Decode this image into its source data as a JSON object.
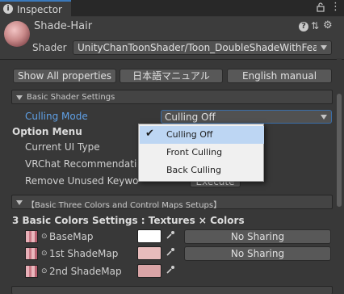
{
  "window": {
    "tab_label": "Inspector",
    "tab_icon": "info-icon",
    "tab_actions": [
      "lock-icon",
      "menu-icon"
    ]
  },
  "header": {
    "material_name": "Shade-Hair",
    "shader_label": "Shader",
    "shader_value": "UnityChanToonShader/Toon_DoubleShadeWithFeath",
    "icons": [
      "help-icon",
      "presets-icon",
      "settings-icon"
    ]
  },
  "buttons": {
    "show_all": "Show All properties",
    "japanese_manual": "日本語マニュアル",
    "english_manual": "English manual"
  },
  "basic_shader_settings": {
    "title": "Basic Shader Settings",
    "culling_label": "Culling Mode",
    "culling_value": "Culling Off",
    "culling_options": [
      {
        "label": "Culling Off",
        "selected": true
      },
      {
        "label": "Front Culling",
        "selected": false
      },
      {
        "label": "Back Culling",
        "selected": false
      }
    ],
    "option_menu": "Option Menu",
    "current_ui_type": "Current UI Type",
    "vrchat_recommendation": "VRChat Recommendation",
    "remove_unused": "Remove Unused Keywo",
    "execute": "Execute"
  },
  "three_colors": {
    "title": "【Basic Three Colors and Control Maps Setups】",
    "subtitle": "3 Basic Colors Settings : Textures × Colors",
    "rows": [
      {
        "label": "BaseMap",
        "color": "#ffffff",
        "sharing": "No Sharing"
      },
      {
        "label": "1st ShadeMap",
        "color": "#e8bcbc",
        "sharing": "No Sharing"
      },
      {
        "label": "2nd ShadeMap",
        "color": "#d9a4a6",
        "sharing": ""
      }
    ]
  },
  "colors": {
    "background": "#383838",
    "accent_blue": "#5fa0e6",
    "tab_highlight": "#3a79bb"
  }
}
